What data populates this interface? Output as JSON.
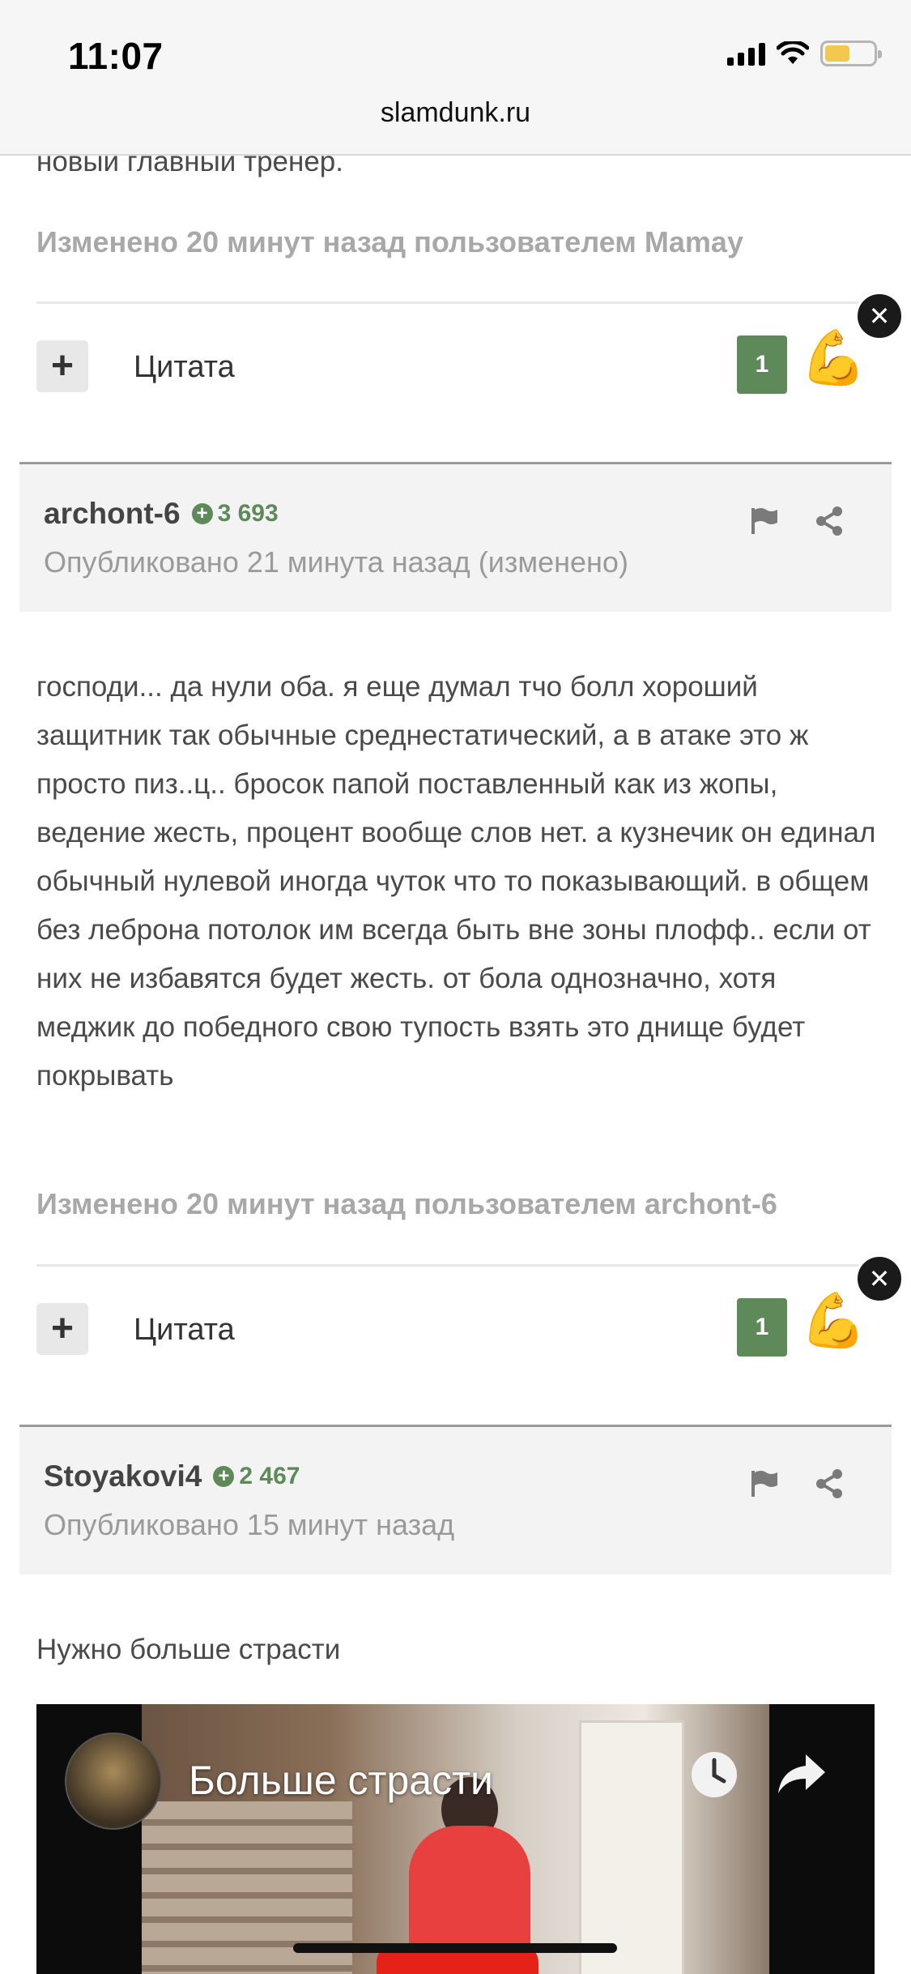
{
  "status_bar": {
    "time": "11:07"
  },
  "browser": {
    "url": "slamdunk.ru"
  },
  "post0": {
    "tail_text": "новый главный тренер.",
    "edited": "Изменено 20 минут назад пользователем Mamay",
    "quote_label": "Цитата",
    "reactions": "1"
  },
  "post1": {
    "author": "archont-6",
    "rep": "3 693",
    "published": "Опубликовано 21 минута назад (изменено)",
    "text": "господи... да нули оба. я еще думал тчо болл хороший защитник так обычные среднестатический, а в атаке это ж просто пиз..ц.. бросок папой поставленный как из жопы, ведение жесть, процент вообще слов нет. а кузнечик он единал обычный нулевой  иногда чуток что то показывающий. в общем без леброна потолок им всегда быть вне зоны плофф.. если от них не избавятся будет жесть. от бола однозначно, хотя меджик до победного свою тупость взять это днище будет покрывать",
    "edited": "Изменено 20 минут назад пользователем archont-6",
    "quote_label": "Цитата",
    "reactions": "1"
  },
  "post2": {
    "author": "Stoyakovi4",
    "rep": "2 467",
    "published": "Опубликовано 15 минут назад",
    "text": "Нужно больше страсти",
    "video_title": "Больше страсти"
  },
  "colors": {
    "rep_green": "#5e8a5a",
    "separator": "#9a9a9a",
    "header_bg": "#f3f3f3"
  }
}
